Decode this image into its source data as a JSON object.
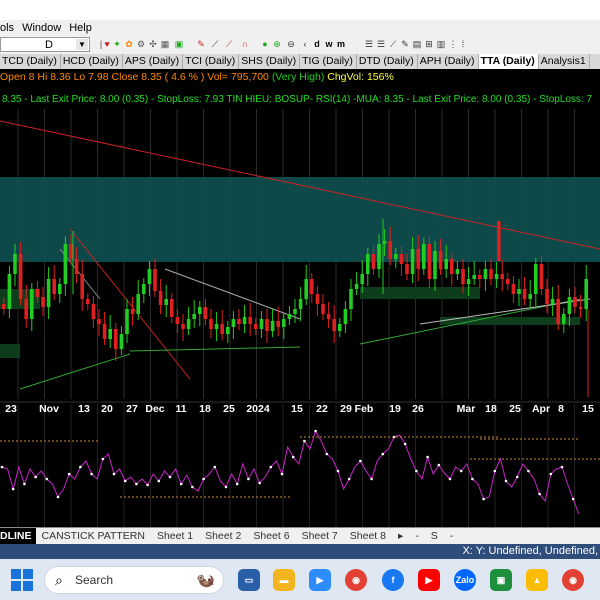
{
  "menu": [
    "ols",
    "Window",
    "Help"
  ],
  "symbol_box": {
    "period": "D"
  },
  "tabs": [
    {
      "label": "TCD (Daily)",
      "active": false
    },
    {
      "label": "HCD (Daily)",
      "active": false
    },
    {
      "label": "APS (Daily)",
      "active": false
    },
    {
      "label": "TCI (Daily)",
      "active": false
    },
    {
      "label": "SHS (Daily)",
      "active": false
    },
    {
      "label": "TIG (Daily)",
      "active": false
    },
    {
      "label": "DTD (Daily)",
      "active": false
    },
    {
      "label": "APH (Daily)",
      "active": false
    },
    {
      "label": "TTA (Daily)",
      "active": true
    },
    {
      "label": "Analysis1",
      "active": false
    }
  ],
  "quote": {
    "open": "Open 8",
    "high": "Hi 8.36",
    "low": "Lo 7.98",
    "close": "Close 8.35",
    "change": "( 4.6 % )",
    "vol": "Vol= 795,700",
    "vol_note": "(Very High)",
    "chgvol": "ChgVol: 156%"
  },
  "signal_text": "8.35 - Last Exit Price: 8.00 (0.35) - StopLoss: 7.93 TIN HIEU: BOSUP- RSI(14)  -MUA: 8.35 - Last Exit Price: 8.00 (0.35) - StopLoss: 7",
  "x_axis_labels": [
    "23",
    "Nov",
    "13",
    "20",
    "27",
    "Dec",
    "11",
    "18",
    "25",
    "2024",
    "15",
    "22",
    "29",
    "Feb",
    "19",
    "26",
    "Mar",
    "18",
    "25",
    "Apr",
    "8",
    "15"
  ],
  "sheets": [
    "DLINE",
    "CANSTICK PATTERN",
    "Sheet 1",
    "Sheet 2",
    "Sheet 6",
    "Sheet 7",
    "Sheet 8"
  ],
  "status": "X: Y: Undefined, Undefined,",
  "taskbar": {
    "search_placeholder": "Search",
    "apps": [
      "file-manager-icon",
      "folder-icon",
      "zoom-icon",
      "chrome-icon",
      "facebook-icon",
      "youtube-icon",
      "zalo-icon",
      "monitor-icon",
      "drive-icon",
      "chrome-badge-icon"
    ]
  },
  "colors": {
    "up": "#22cc22",
    "down": "#e02020",
    "zone": "#0e4d4d",
    "rsi": "#cc22cc",
    "trendline": "#cc2222",
    "quote_text": "#ff8800",
    "signal_text": "#22dd22"
  }
}
